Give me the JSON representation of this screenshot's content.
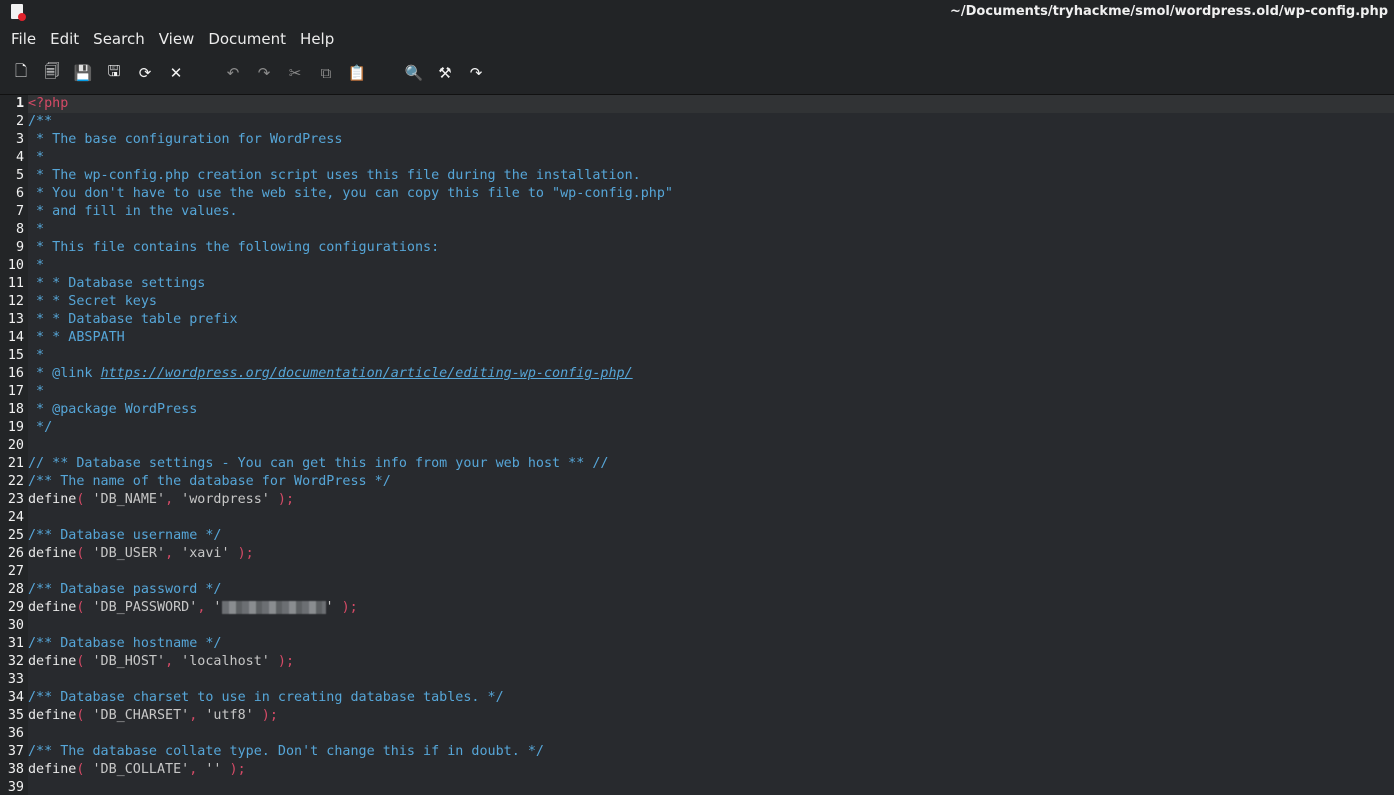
{
  "window": {
    "title": "~/Documents/tryhackme/smol/wordpress.old/wp-config.php"
  },
  "menu": [
    "File",
    "Edit",
    "Search",
    "View",
    "Document",
    "Help"
  ],
  "toolbar": [
    {
      "name": "new-document-icon",
      "glyph": "🗋",
      "enabled": true
    },
    {
      "name": "open-document-icon",
      "glyph": "🗐",
      "enabled": true
    },
    {
      "name": "save-icon",
      "glyph": "💾",
      "enabled": false
    },
    {
      "name": "save-as-icon",
      "glyph": "🖫",
      "enabled": true
    },
    {
      "name": "reload-icon",
      "glyph": "⟳",
      "enabled": true
    },
    {
      "name": "close-icon",
      "glyph": "✕",
      "enabled": true
    },
    {
      "name": "undo-icon",
      "glyph": "↶",
      "enabled": false
    },
    {
      "name": "redo-icon",
      "glyph": "↷",
      "enabled": false
    },
    {
      "name": "cut-icon",
      "glyph": "✂",
      "enabled": false
    },
    {
      "name": "copy-icon",
      "glyph": "⧉",
      "enabled": false
    },
    {
      "name": "paste-icon",
      "glyph": "📋",
      "enabled": true
    },
    {
      "name": "search-icon",
      "glyph": "🔍",
      "enabled": true
    },
    {
      "name": "replace-icon",
      "glyph": "⚒",
      "enabled": true
    },
    {
      "name": "goto-line-icon",
      "glyph": "↷",
      "enabled": true
    }
  ],
  "editor": {
    "current_line": 1,
    "lines": [
      {
        "n": "1",
        "parts": [
          {
            "t": "<?php",
            "c": "tag"
          }
        ]
      },
      {
        "n": "2",
        "parts": [
          {
            "t": "/**",
            "c": "comment"
          }
        ]
      },
      {
        "n": "3",
        "parts": [
          {
            "t": " * The base configuration for WordPress",
            "c": "comment"
          }
        ]
      },
      {
        "n": "4",
        "parts": [
          {
            "t": " *",
            "c": "comment"
          }
        ]
      },
      {
        "n": "5",
        "parts": [
          {
            "t": " * The wp-config.php creation script uses this file during the installation.",
            "c": "comment"
          }
        ]
      },
      {
        "n": "6",
        "parts": [
          {
            "t": " * You don't have to use the web site, you can copy this file to \"wp-config.php\"",
            "c": "comment"
          }
        ]
      },
      {
        "n": "7",
        "parts": [
          {
            "t": " * and fill in the values.",
            "c": "comment"
          }
        ]
      },
      {
        "n": "8",
        "parts": [
          {
            "t": " *",
            "c": "comment"
          }
        ]
      },
      {
        "n": "9",
        "parts": [
          {
            "t": " * This file contains the following configurations:",
            "c": "comment"
          }
        ]
      },
      {
        "n": "10",
        "parts": [
          {
            "t": " *",
            "c": "comment"
          }
        ]
      },
      {
        "n": "11",
        "parts": [
          {
            "t": " * * Database settings",
            "c": "comment"
          }
        ]
      },
      {
        "n": "12",
        "parts": [
          {
            "t": " * * Secret keys",
            "c": "comment"
          }
        ]
      },
      {
        "n": "13",
        "parts": [
          {
            "t": " * * Database table prefix",
            "c": "comment"
          }
        ]
      },
      {
        "n": "14",
        "parts": [
          {
            "t": " * * ABSPATH",
            "c": "comment"
          }
        ]
      },
      {
        "n": "15",
        "parts": [
          {
            "t": " *",
            "c": "comment"
          }
        ]
      },
      {
        "n": "16",
        "parts": [
          {
            "t": " * @link ",
            "c": "comment"
          },
          {
            "t": "https://wordpress.org/documentation/article/editing-wp-config-php/",
            "c": "link"
          }
        ]
      },
      {
        "n": "17",
        "parts": [
          {
            "t": " *",
            "c": "comment"
          }
        ]
      },
      {
        "n": "18",
        "parts": [
          {
            "t": " * @package WordPress",
            "c": "comment"
          }
        ]
      },
      {
        "n": "19",
        "parts": [
          {
            "t": " */",
            "c": "comment"
          }
        ]
      },
      {
        "n": "20",
        "parts": []
      },
      {
        "n": "21",
        "parts": [
          {
            "t": "// ** Database settings - You can get this info from your web host ** //",
            "c": "comment"
          }
        ]
      },
      {
        "n": "22",
        "parts": [
          {
            "t": "/** The name of the database for WordPress */",
            "c": "comment"
          }
        ]
      },
      {
        "n": "23",
        "parts": [
          {
            "t": "define",
            "c": ""
          },
          {
            "t": "(",
            "c": "punc"
          },
          {
            "t": " 'DB_NAME'",
            "c": "str"
          },
          {
            "t": ",",
            "c": "punc"
          },
          {
            "t": " 'wordpress'",
            "c": "str"
          },
          {
            "t": " );",
            "c": "punc"
          }
        ]
      },
      {
        "n": "24",
        "parts": []
      },
      {
        "n": "25",
        "parts": [
          {
            "t": "/** Database username */",
            "c": "comment"
          }
        ]
      },
      {
        "n": "26",
        "parts": [
          {
            "t": "define",
            "c": ""
          },
          {
            "t": "(",
            "c": "punc"
          },
          {
            "t": " 'DB_USER'",
            "c": "str"
          },
          {
            "t": ",",
            "c": "punc"
          },
          {
            "t": " 'xavi'",
            "c": "str"
          },
          {
            "t": " );",
            "c": "punc"
          }
        ]
      },
      {
        "n": "27",
        "parts": []
      },
      {
        "n": "28",
        "parts": [
          {
            "t": "/** Database password */",
            "c": "comment"
          }
        ]
      },
      {
        "n": "29",
        "parts": [
          {
            "t": "define",
            "c": ""
          },
          {
            "t": "(",
            "c": "punc"
          },
          {
            "t": " 'DB_PASSWORD'",
            "c": "str"
          },
          {
            "t": ",",
            "c": "punc"
          },
          {
            "t": " '",
            "c": "str"
          },
          {
            "t": "",
            "c": "redacted"
          },
          {
            "t": "'",
            "c": "str"
          },
          {
            "t": " );",
            "c": "punc"
          }
        ]
      },
      {
        "n": "30",
        "parts": []
      },
      {
        "n": "31",
        "parts": [
          {
            "t": "/** Database hostname */",
            "c": "comment"
          }
        ]
      },
      {
        "n": "32",
        "parts": [
          {
            "t": "define",
            "c": ""
          },
          {
            "t": "(",
            "c": "punc"
          },
          {
            "t": " 'DB_HOST'",
            "c": "str"
          },
          {
            "t": ",",
            "c": "punc"
          },
          {
            "t": " 'localhost'",
            "c": "str"
          },
          {
            "t": " );",
            "c": "punc"
          }
        ]
      },
      {
        "n": "33",
        "parts": []
      },
      {
        "n": "34",
        "parts": [
          {
            "t": "/** Database charset to use in creating database tables. */",
            "c": "comment"
          }
        ]
      },
      {
        "n": "35",
        "parts": [
          {
            "t": "define",
            "c": ""
          },
          {
            "t": "(",
            "c": "punc"
          },
          {
            "t": " 'DB_CHARSET'",
            "c": "str"
          },
          {
            "t": ",",
            "c": "punc"
          },
          {
            "t": " 'utf8'",
            "c": "str"
          },
          {
            "t": " );",
            "c": "punc"
          }
        ]
      },
      {
        "n": "36",
        "parts": []
      },
      {
        "n": "37",
        "parts": [
          {
            "t": "/** The database collate type. Don't change this if in doubt. */",
            "c": "comment"
          }
        ]
      },
      {
        "n": "38",
        "parts": [
          {
            "t": "define",
            "c": ""
          },
          {
            "t": "(",
            "c": "punc"
          },
          {
            "t": " 'DB_COLLATE'",
            "c": "str"
          },
          {
            "t": ",",
            "c": "punc"
          },
          {
            "t": " ''",
            "c": "str"
          },
          {
            "t": " );",
            "c": "punc"
          }
        ]
      },
      {
        "n": "39",
        "parts": []
      }
    ]
  }
}
